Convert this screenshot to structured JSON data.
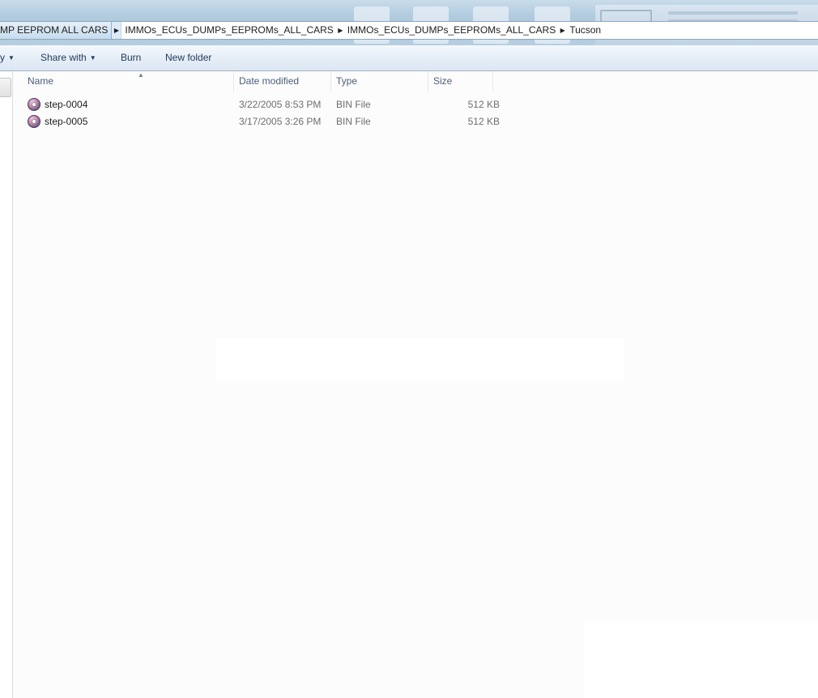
{
  "address_bar": {
    "crumbs": [
      "MP EEPROM ALL CARS",
      "IMMOs_ECUs_DUMPs_EEPROMs_ALL_CARS",
      "IMMOs_ECUs_DUMPs_EEPROMs_ALL_CARS",
      "Tucson"
    ]
  },
  "toolbar": {
    "organize_label": "y",
    "share_label": "Share with",
    "burn_label": "Burn",
    "new_folder_label": "New folder"
  },
  "columns": {
    "name": "Name",
    "date": "Date modified",
    "type": "Type",
    "size": "Size"
  },
  "files": [
    {
      "name": "step-0004",
      "date": "3/22/2005 8:53 PM",
      "type": "BIN File",
      "size": "512 KB",
      "icon": "bin-file-icon"
    },
    {
      "name": "step-0005",
      "date": "3/17/2005 3:26 PM",
      "type": "BIN File",
      "size": "512 KB",
      "icon": "bin-file-icon"
    }
  ],
  "colors": {
    "accent": "#1e395b",
    "header_text": "#4c607a",
    "detail_text": "#6d6d6d"
  }
}
